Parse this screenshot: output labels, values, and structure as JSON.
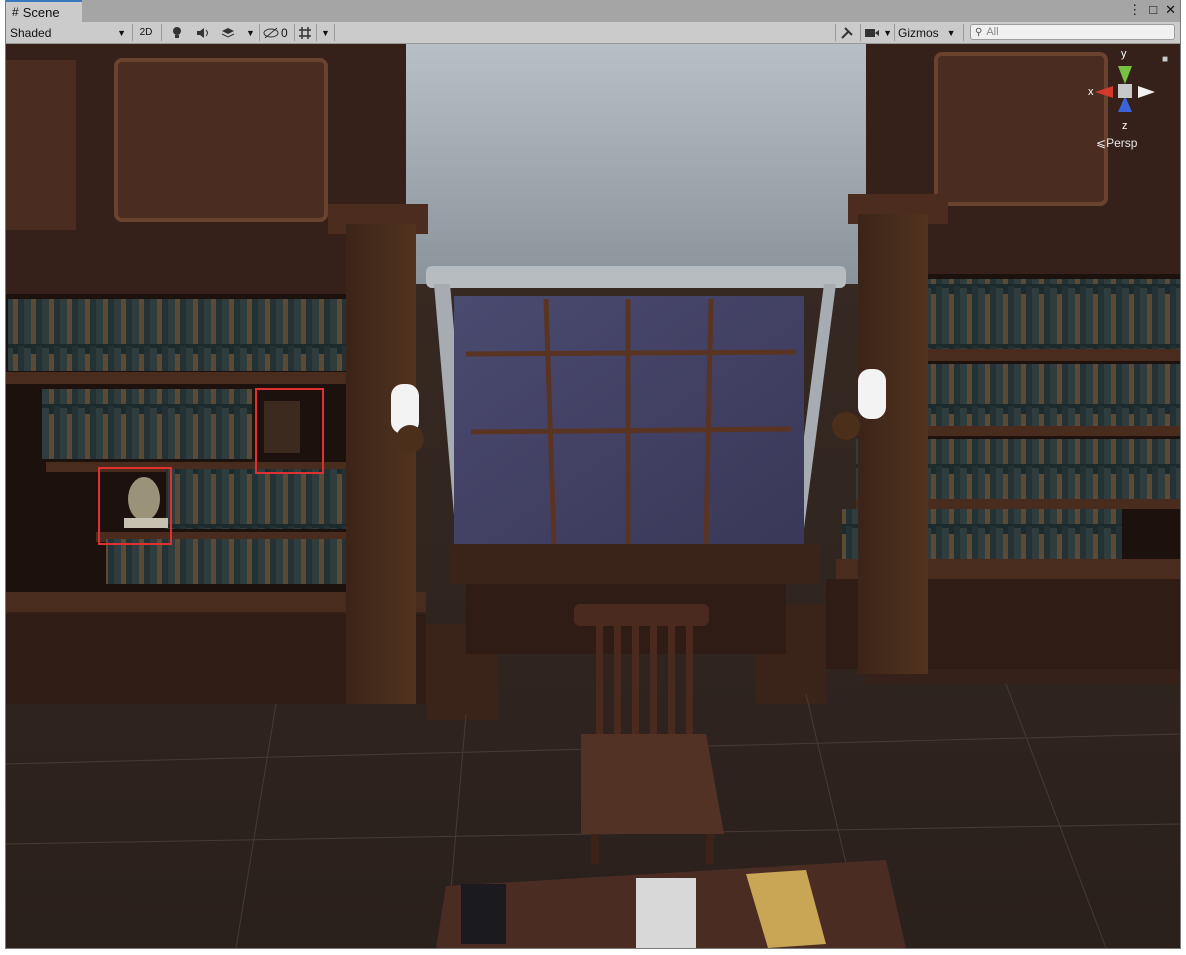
{
  "window": {
    "tab_label": "Scene",
    "tab_icon": "grid-icon",
    "controls": {
      "menu": "⋮",
      "maximize": "□",
      "close": "✕"
    }
  },
  "toolbar": {
    "draw_mode": "Shaded",
    "toggle_2d": "2D",
    "hidden_count": "0",
    "gizmos_label": "Gizmos",
    "search_placeholder": "All"
  },
  "orientation_gizmo": {
    "axis_x": "x",
    "axis_y": "y",
    "axis_z": "z",
    "projection_label": "Persp"
  },
  "highlight_color": "#e03030",
  "accent_color": "#3a79bb"
}
